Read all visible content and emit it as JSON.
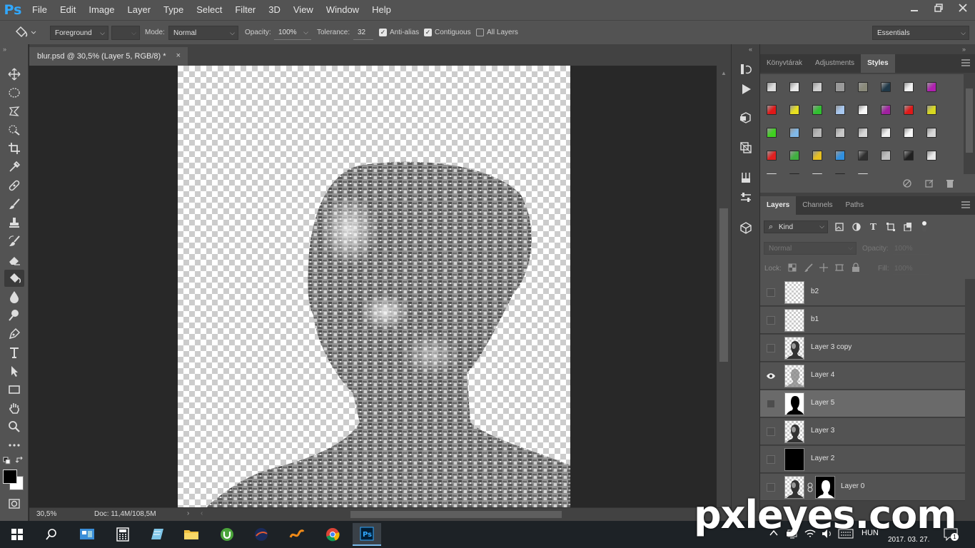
{
  "app": {
    "logo": "Ps"
  },
  "menu": [
    "File",
    "Edit",
    "Image",
    "Layer",
    "Type",
    "Select",
    "Filter",
    "3D",
    "View",
    "Window",
    "Help"
  ],
  "window_controls": [
    "minimize-icon",
    "restore-icon",
    "close-icon"
  ],
  "options": {
    "fill_source": "Foreground",
    "mode_label": "Mode:",
    "mode_value": "Normal",
    "opacity_label": "Opacity:",
    "opacity_value": "100%",
    "tolerance_label": "Tolerance:",
    "tolerance_value": "32",
    "antialias_label": "Anti-alias",
    "antialias_checked": true,
    "contiguous_label": "Contiguous",
    "contiguous_checked": true,
    "all_layers_label": "All Layers",
    "all_layers_checked": false,
    "workspace": "Essentials"
  },
  "document": {
    "tab_title": "blur.psd @ 30,5% (Layer 5, RGB/8) *",
    "zoom": "30,5%",
    "doc_info": "Doc: 11,4M/108,5M"
  },
  "tools": [
    "move-icon",
    "marquee-icon",
    "lasso-icon",
    "quick-select-icon",
    "crop-icon",
    "eyedropper-icon",
    "healing-icon",
    "brush-icon",
    "stamp-icon",
    "history-brush-icon",
    "eraser-icon",
    "paint-bucket-icon",
    "blur-icon",
    "dodge-icon",
    "pen-icon",
    "type-icon",
    "path-select-icon",
    "rectangle-icon",
    "hand-icon",
    "zoom-icon",
    "more-icon"
  ],
  "styles_panel": {
    "tabs": [
      "Könyvtárak",
      "Adjustments",
      "Styles"
    ],
    "active_tab": "Styles",
    "swatch_colors": [
      [
        "#dcdcdc",
        "#e8e8e8",
        "#d0d0d0",
        "#9a9a9a",
        "#8a8a7a",
        "#203848",
        "#f2f2f2",
        "#b020b0"
      ],
      [
        "#e01818",
        "#e8e020",
        "#30c030",
        "#a8c8f0",
        "#f8f8f8",
        "#a020a0",
        "#e01818",
        "#d8d820"
      ],
      [
        "#40d020",
        "#80b8e8",
        "#b8b8b8",
        "#c8c8c8",
        "#d8d8d8",
        "#f0f0f0",
        "#f8f8f8",
        "#d8d8d8"
      ],
      [
        "#e02020",
        "#40b040",
        "#e8c020",
        "#3090e0",
        "#303030",
        "#c0c0c0",
        "#202020",
        "#e8e8e8"
      ]
    ]
  },
  "layers_panel": {
    "tabs": [
      "Layers",
      "Channels",
      "Paths"
    ],
    "active_tab": "Layers",
    "filter_kind": "Kind",
    "blend_mode": "Normal",
    "opacity_label": "Opacity:",
    "opacity_value": "100%",
    "lock_label": "Lock:",
    "fill_label": "Fill:",
    "fill_value": "100%",
    "layers": [
      {
        "name": "b2",
        "visible": false,
        "thumb": "transparent"
      },
      {
        "name": "b1",
        "visible": false,
        "thumb": "transparent"
      },
      {
        "name": "Layer 3 copy",
        "visible": false,
        "thumb": "portrait"
      },
      {
        "name": "Layer 4",
        "visible": true,
        "thumb": "text-portrait"
      },
      {
        "name": "Layer 5",
        "visible": false,
        "thumb": "silhouette",
        "selected": true
      },
      {
        "name": "Layer 3",
        "visible": false,
        "thumb": "portrait"
      },
      {
        "name": "Layer 2",
        "visible": false,
        "thumb": "black"
      },
      {
        "name": "Layer 0",
        "visible": false,
        "thumb": "portrait-mask"
      }
    ]
  },
  "taskbar": {
    "language": "HUN",
    "date": "2017. 03. 27.",
    "notifications": "1"
  },
  "watermark": "pxleyes.com"
}
